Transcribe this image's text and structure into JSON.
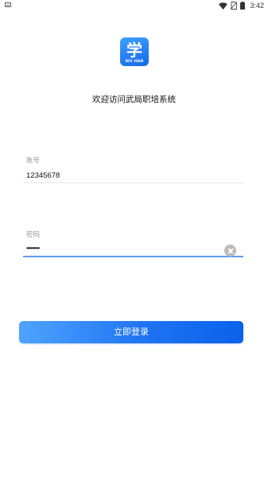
{
  "status_bar": {
    "time": "3:42",
    "icons": [
      "notification-icon",
      "wifi-icon",
      "no-sim-icon",
      "battery-icon"
    ]
  },
  "logo": {
    "glyph": "学",
    "caption": "WU HAN",
    "colors": {
      "top": "#3fa0ff",
      "bottom": "#1668e8"
    }
  },
  "welcome_title": "欢迎访问武局职培系统",
  "account": {
    "label": "账号",
    "value": "12345678"
  },
  "password": {
    "label": "密码",
    "value": "•••••••••"
  },
  "login_button": {
    "label": "立即登录",
    "colors": {
      "start": "#4fa3ff",
      "end": "#0a62ea"
    }
  }
}
